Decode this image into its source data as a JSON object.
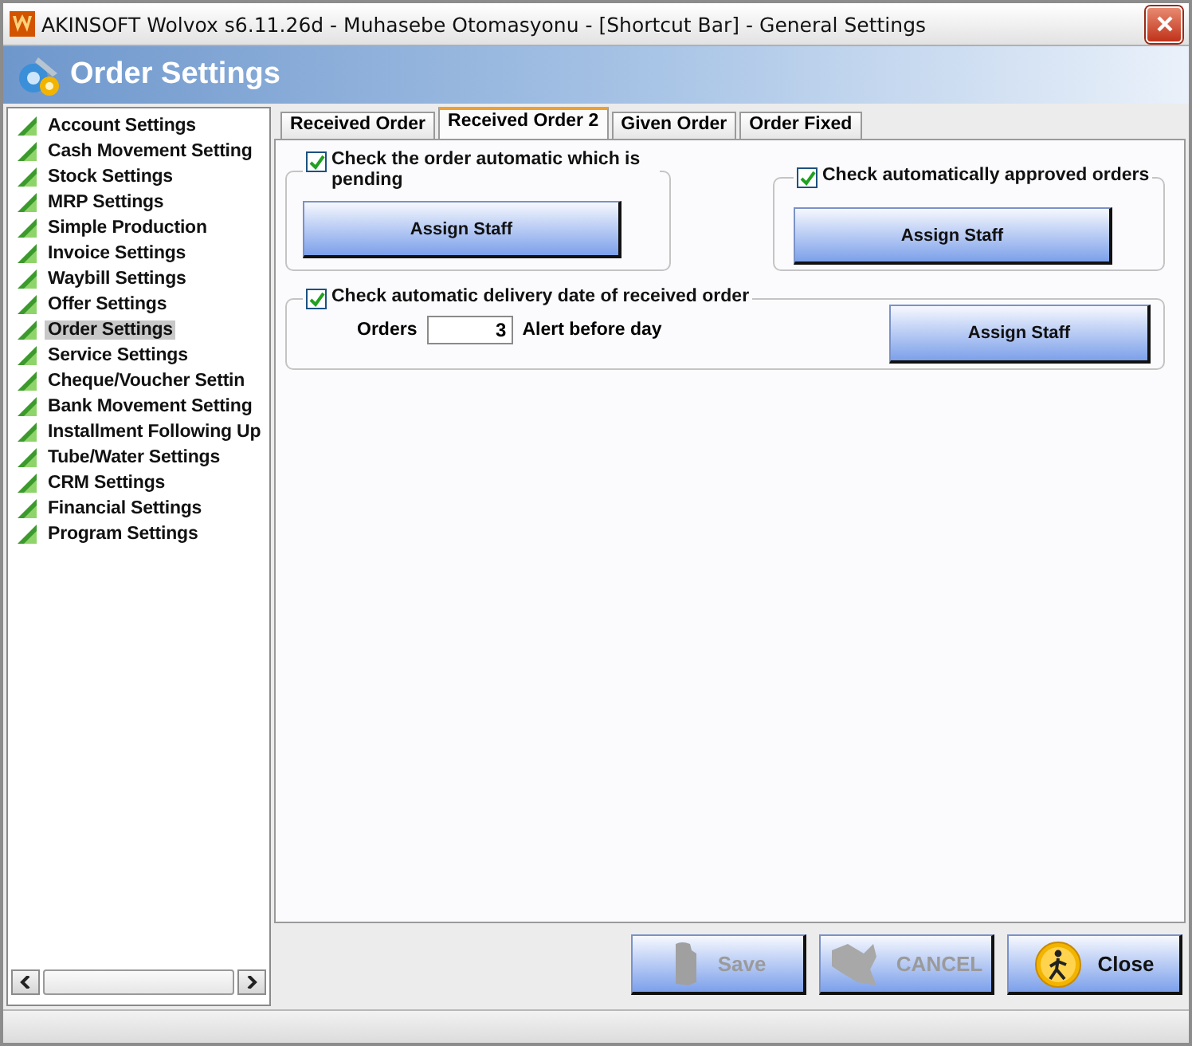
{
  "window": {
    "title": "AKINSOFT Wolvox s6.11.26d - Muhasebe Otomasyonu - [Shortcut Bar] - General Settings"
  },
  "header": {
    "title": "Order Settings"
  },
  "sidebar": {
    "items": [
      {
        "label": "Account Settings",
        "selected": false
      },
      {
        "label": "Cash Movement Setting",
        "selected": false
      },
      {
        "label": "Stock Settings",
        "selected": false
      },
      {
        "label": "MRP Settings",
        "selected": false
      },
      {
        "label": "Simple Production",
        "selected": false
      },
      {
        "label": "Invoice Settings",
        "selected": false
      },
      {
        "label": "Waybill Settings",
        "selected": false
      },
      {
        "label": "Offer Settings",
        "selected": false
      },
      {
        "label": "Order Settings",
        "selected": true
      },
      {
        "label": "Service Settings",
        "selected": false
      },
      {
        "label": "Cheque/Voucher Settin",
        "selected": false
      },
      {
        "label": "Bank Movement Setting",
        "selected": false
      },
      {
        "label": "Installment Following Up",
        "selected": false
      },
      {
        "label": "Tube/Water Settings",
        "selected": false
      },
      {
        "label": "CRM Settings",
        "selected": false
      },
      {
        "label": "Financial Settings",
        "selected": false
      },
      {
        "label": "Program Settings",
        "selected": false
      }
    ]
  },
  "tabs": [
    {
      "label": "Received Order",
      "selected": false
    },
    {
      "label": "Received Order 2",
      "selected": true
    },
    {
      "label": "Given Order",
      "selected": false
    },
    {
      "label": "Order Fixed",
      "selected": false
    }
  ],
  "groups": [
    {
      "kind": "check_button",
      "label": "Check the order automatic which is pending",
      "checked": true,
      "button": "Assign Staff"
    },
    {
      "kind": "check_button",
      "label": "Check automatically approved orders",
      "checked": true,
      "button": "Assign Staff"
    },
    {
      "kind": "check_field",
      "label": "Check automatic delivery date of received order",
      "checked": true,
      "field_label": "Orders",
      "value": "3",
      "suffix": "Alert before day",
      "button": "Assign Staff"
    }
  ],
  "buttons": [
    {
      "kind": "save",
      "label": "Save",
      "disabled": true
    },
    {
      "kind": "cancel",
      "label": "CANCEL",
      "disabled": true
    },
    {
      "kind": "close",
      "label": "Close",
      "disabled": false
    }
  ]
}
